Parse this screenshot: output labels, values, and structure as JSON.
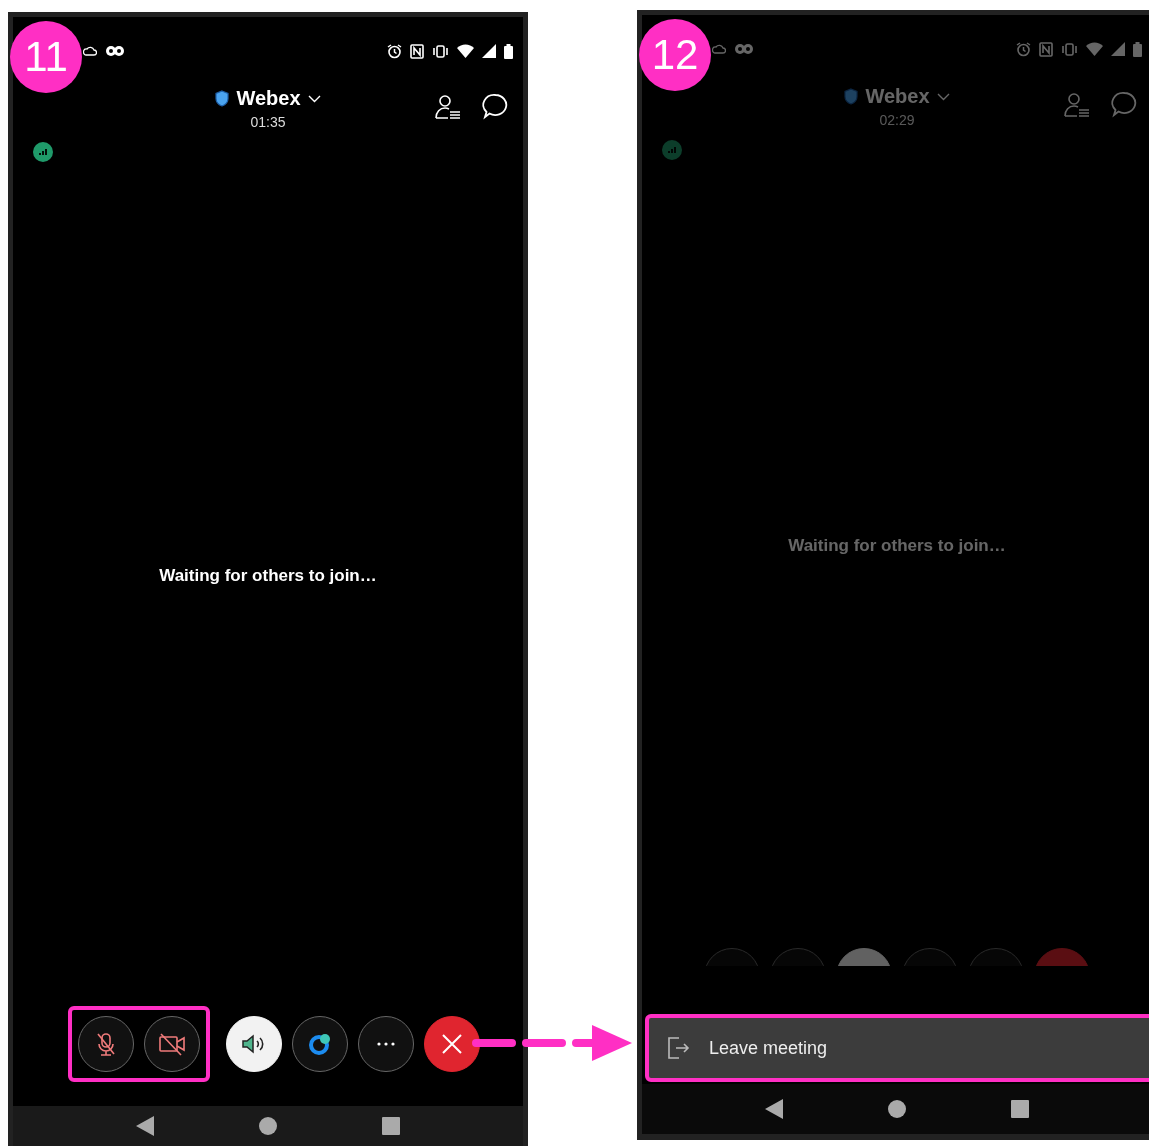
{
  "steps": [
    {
      "number": "11",
      "dimmed": false,
      "title": "Webex",
      "timer": "01:35",
      "message": "Waiting for others to join…",
      "control_groups": [
        {
          "highlighted": true,
          "controls": [
            {
              "kind": "mic",
              "muted": true
            },
            {
              "kind": "camera",
              "muted": true
            }
          ]
        },
        {
          "highlighted": false,
          "controls": [
            {
              "kind": "speaker"
            },
            {
              "kind": "app"
            },
            {
              "kind": "more"
            },
            {
              "kind": "end"
            }
          ]
        }
      ]
    },
    {
      "number": "12",
      "dimmed": true,
      "title": "Webex",
      "timer": "02:29",
      "message": "Waiting for others to join…",
      "control_groups": [
        {
          "controls": [
            {
              "kind": "mic"
            },
            {
              "kind": "camera"
            },
            {
              "kind": "speaker"
            },
            {
              "kind": "app"
            },
            {
              "kind": "more"
            },
            {
              "kind": "end"
            }
          ]
        }
      ],
      "sheet": {
        "label": "Leave meeting",
        "highlighted": true
      }
    }
  ]
}
